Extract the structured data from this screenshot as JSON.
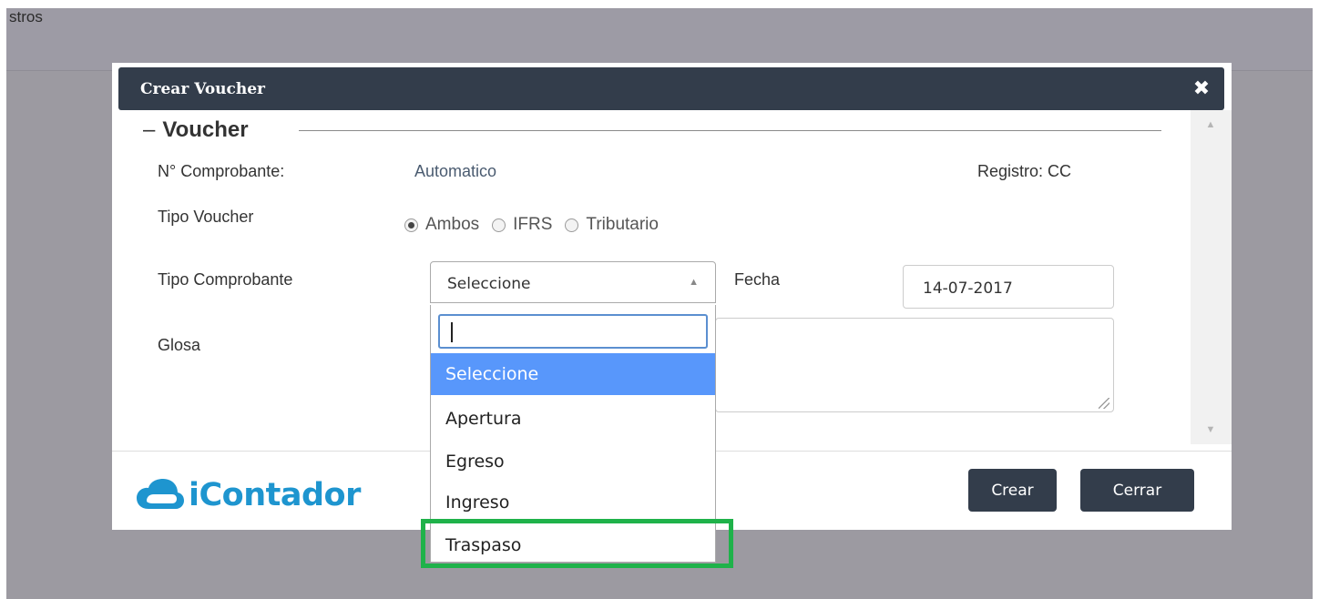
{
  "background": {
    "partial_text": "stros"
  },
  "modal": {
    "title": "Crear Voucher",
    "close_icon": "close-icon",
    "section_legend": "Voucher",
    "fields": {
      "comprobante_label": "N° Comprobante:",
      "comprobante_value": "Automatico",
      "registro_label": "Registro: CC",
      "tipo_voucher_label": "Tipo Voucher",
      "tipo_voucher_options": [
        "Ambos",
        "IFRS",
        "Tributario"
      ],
      "tipo_voucher_selected": "Ambos",
      "tipo_comprobante_label": "Tipo Comprobante",
      "tipo_comprobante_value": "Seleccione",
      "fecha_label": "Fecha",
      "fecha_value": "14-07-2017",
      "glosa_label": "Glosa",
      "glosa_value": ""
    },
    "footer": {
      "logo_text": "iContador",
      "crear_label": "Crear",
      "cerrar_label": "Cerrar"
    }
  },
  "dropdown": {
    "search_value": "",
    "options": [
      "Seleccione",
      "Apertura",
      "Egreso",
      "Ingreso",
      "Traspaso"
    ],
    "highlighted_option": "Seleccione",
    "emphasized_option": "Traspaso"
  },
  "colors": {
    "header": "#333d4b",
    "overlay": "#9c9aa1",
    "highlight": "#5897fb",
    "emphasis_box": "#1fb24a",
    "brand": "#1e95cf"
  }
}
